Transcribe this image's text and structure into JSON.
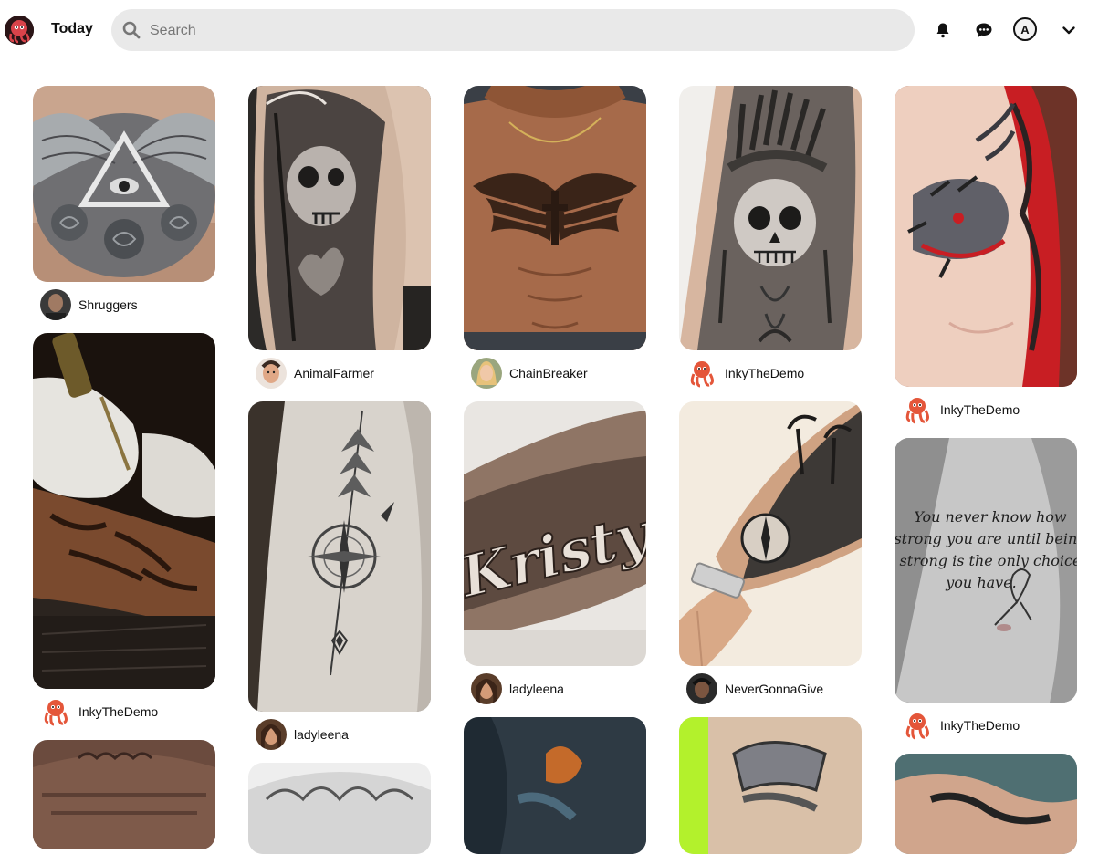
{
  "header": {
    "today_label": "Today",
    "search_placeholder": "Search",
    "account_initial": "A",
    "icons": [
      "logo-icon",
      "search-icon",
      "bell-icon",
      "chat-icon",
      "chevron-down-icon"
    ]
  },
  "pins": [
    {
      "user": "Shruggers",
      "avatar": "dark-portrait",
      "subject": "eye-pyramid-wings-chest-tattoo"
    },
    {
      "user": "InkyTheDemo",
      "avatar": "octopus",
      "subject": "tattoo-artist-working"
    },
    {
      "user": "",
      "avatar": "",
      "subject": "back-script-tattoo"
    },
    {
      "user": "AnimalFarmer",
      "avatar": "face-portrait",
      "subject": "grim-reaper-rib-tattoo"
    },
    {
      "user": "ladyleena",
      "avatar": "woman-portrait",
      "subject": "compass-arrow-forearm-tattoo"
    },
    {
      "user": "",
      "avatar": "",
      "subject": "hair-image"
    },
    {
      "user": "ChainBreaker",
      "avatar": "blonde-portrait",
      "subject": "chest-wings-cross-tattoo"
    },
    {
      "user": "ladyleena",
      "avatar": "woman-portrait",
      "subject": "kristy-lettering-tattoo"
    },
    {
      "user": "",
      "avatar": "",
      "subject": "dark-colour-tattoo"
    },
    {
      "user": "InkyTheDemo",
      "avatar": "octopus",
      "subject": "native-headdress-skull-tattoo"
    },
    {
      "user": "NeverGonnaGive",
      "avatar": "dark-portrait",
      "subject": "palm-tree-compass-sleeve"
    },
    {
      "user": "",
      "avatar": "",
      "subject": "scroll-tattoo"
    },
    {
      "user": "InkyTheDemo",
      "avatar": "octopus",
      "subject": "red-dragon-sleeve"
    },
    {
      "user": "InkyTheDemo",
      "avatar": "octopus",
      "subject": "script-quote-chest-tattoo"
    },
    {
      "user": "",
      "avatar": "",
      "subject": "hand-tattoo"
    }
  ],
  "quote_lines": [
    "You never know how",
    "strong you are until being",
    "strong is the only choice",
    "you have."
  ],
  "script_word": "Kristy"
}
